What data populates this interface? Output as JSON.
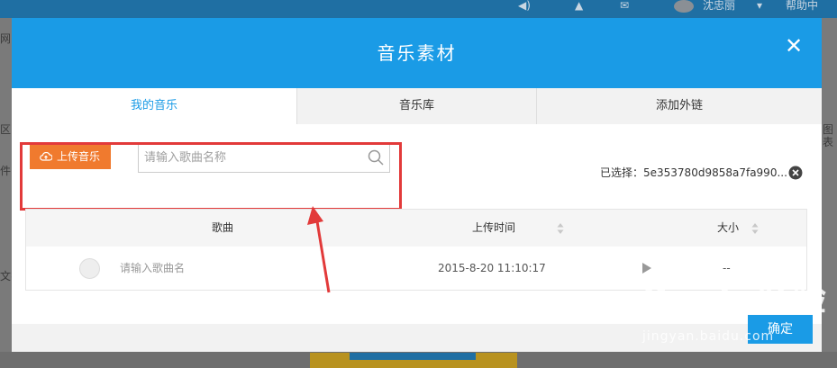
{
  "background": {
    "topbar_user": "沈忠丽",
    "topbar_help": "帮助中",
    "frag_left_1": "网",
    "frag_left_2": "区",
    "frag_left_3": "件",
    "frag_left_4": "文字",
    "frag_right_1": "图表"
  },
  "modal": {
    "title": "音乐素材",
    "close_glyph": "✕",
    "tabs": [
      {
        "label": "我的音乐"
      },
      {
        "label": "音乐库"
      },
      {
        "label": "添加外链"
      }
    ],
    "upload_button": "上传音乐",
    "search_placeholder": "请输入歌曲名称",
    "selected_text": "已选择：5e353780d9858a7fa990...",
    "table": {
      "headers": {
        "song": "歌曲",
        "upload_time": "上传时间",
        "size": "大小"
      },
      "rows": [
        {
          "name": "请输入歌曲名",
          "upload_time": "2015-8-20 11:10:17",
          "size": "--"
        }
      ]
    },
    "confirm_button": "确定"
  },
  "watermark": {
    "text": "Baidu经验",
    "sub": "jingyan.baidu.com"
  },
  "colors": {
    "header_blue": "#1a9be6",
    "upload_orange": "#f07a2e",
    "highlight_red": "#e23a3a"
  }
}
